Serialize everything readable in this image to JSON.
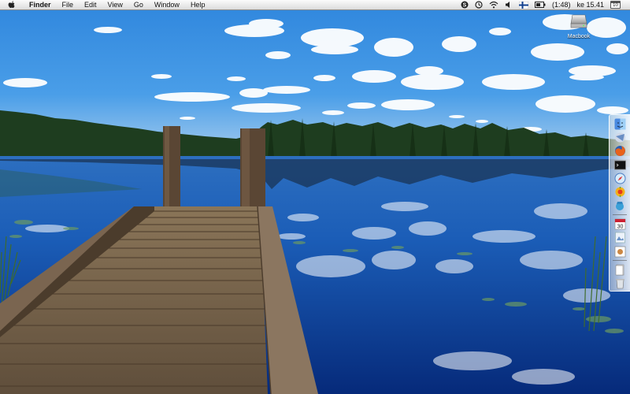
{
  "menubar": {
    "app_name": "Finder",
    "menus": [
      "File",
      "Edit",
      "View",
      "Go",
      "Window",
      "Help"
    ],
    "battery_time": "(1:48)",
    "clock": "ke 15.41",
    "calendar_day": "10"
  },
  "desktop": {
    "drive_label": "Macbook"
  },
  "dock": {
    "items": [
      "finder-icon",
      "mail-icon",
      "firefox-icon",
      "terminal-icon",
      "safari-icon",
      "system-tool-icon",
      "spotlight-icon",
      "calendar-icon",
      "preview-icon",
      "photo-icon",
      "document-icon",
      "trash-icon"
    ]
  },
  "colors": {
    "sky_top": "#3a8fe0",
    "lake": "#1a5fb8",
    "forest": "#1c3b1e",
    "dock_wood": "#7e6a52"
  }
}
